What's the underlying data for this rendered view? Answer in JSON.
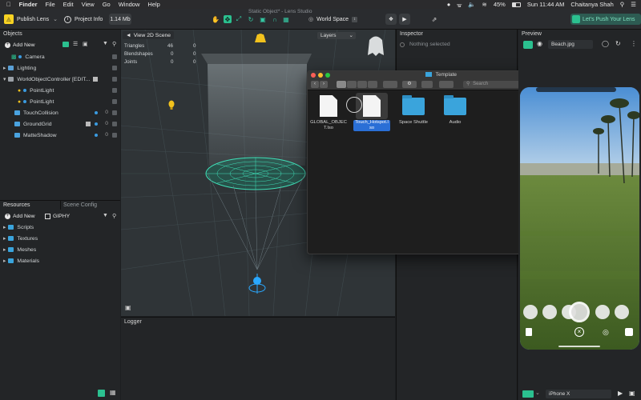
{
  "menubar": {
    "app": "Finder",
    "items": [
      "File",
      "Edit",
      "View",
      "Go",
      "Window",
      "Help"
    ],
    "battery": "45%",
    "clock": "Sun 11:44 AM",
    "user": "Chaitanya Shah"
  },
  "window_title": "Static Object* - Lens Studio",
  "toolbar": {
    "publish_label": "Publish Lens",
    "project_info_label": "Project Info",
    "size_label": "1.14 Mb",
    "space_label": "World Space",
    "push_label": "Let's Push Your Lens"
  },
  "objects_panel": {
    "title": "Objects",
    "add_new": "Add New",
    "items": [
      {
        "label": "Camera"
      },
      {
        "label": "Lighting"
      },
      {
        "label": "WorldObjectController [EDIT..."
      },
      {
        "label": "PointLight"
      },
      {
        "label": "PointLight"
      },
      {
        "label": "TouchCollision",
        "count": "0"
      },
      {
        "label": "GroundGrid",
        "count": "0"
      },
      {
        "label": "MatteShadow",
        "count": "0"
      }
    ]
  },
  "viewport": {
    "view_label": "View 2D Scene",
    "layers_label": "Layers",
    "stats": [
      {
        "label": "Triangles",
        "value": "46",
        "value2": "0"
      },
      {
        "label": "Blendshapes",
        "value": "0",
        "value2": "0"
      },
      {
        "label": "Joints",
        "value": "0",
        "value2": "0"
      }
    ]
  },
  "resources_panel": {
    "tab_resources": "Resources",
    "tab_scene_config": "Scene Config",
    "add_new": "Add New",
    "giphy": "GIPHY",
    "items": [
      "Scripts",
      "Textures",
      "Meshes",
      "Materials"
    ]
  },
  "inspector": {
    "title": "Inspector",
    "empty": "Nothing selected"
  },
  "logger": {
    "title": "Logger"
  },
  "preview": {
    "title": "Preview",
    "file_label": "Beach.jpg",
    "device_label": "iPhone X"
  },
  "finder": {
    "title": "Template",
    "search_placeholder": "Search",
    "files": [
      {
        "name": "GLOBAL_OBJECT.lso",
        "kind": "document"
      },
      {
        "name": "Touch_Hotspot.lso",
        "kind": "document",
        "selected": true
      },
      {
        "name": "Space Shuttle",
        "kind": "folder"
      },
      {
        "name": "Audio",
        "kind": "folder"
      }
    ]
  },
  "colors": {
    "accent": "#2bc08f",
    "folder": "#3aa4dc",
    "selection": "#2a6fd6",
    "publish_badge": "#f7d223"
  }
}
